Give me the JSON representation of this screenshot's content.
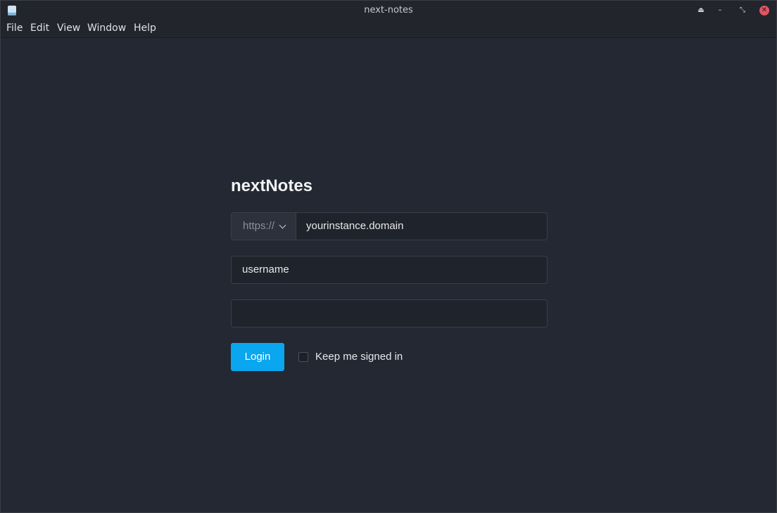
{
  "window": {
    "title": "next-notes",
    "controls": {
      "shade_icon": "eject-icon",
      "minimize_icon": "minimize-icon",
      "restore_icon": "restore-icon",
      "close_icon": "close-icon",
      "shade_glyph": "⏏",
      "minimize_glyph": "–",
      "restore_glyph": "⤡",
      "close_glyph": "✕"
    }
  },
  "menubar": {
    "items": [
      "File",
      "Edit",
      "View",
      "Window",
      "Help"
    ]
  },
  "login": {
    "title": "nextNotes",
    "protocol": "https://",
    "domain_placeholder": "yourinstance.domain",
    "username_placeholder": "username",
    "password_value": "",
    "login_label": "Login",
    "keep_signed_in_label": "Keep me signed in",
    "keep_signed_in_checked": false
  },
  "colors": {
    "accent": "#0aa6ef",
    "background": "#232833",
    "close_button": "#e05563"
  }
}
